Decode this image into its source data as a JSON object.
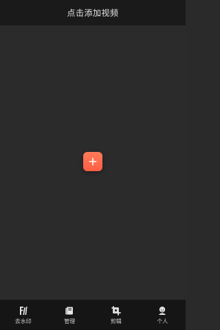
{
  "topbar": {
    "title": "点击添加视频"
  },
  "bottom_nav": {
    "items": [
      {
        "label": "去水印",
        "icon": "watermark-remove-icon"
      },
      {
        "label": "管理",
        "icon": "manage-icon"
      },
      {
        "label": "剪辑",
        "icon": "crop-icon"
      },
      {
        "label": "个人",
        "icon": "user-icon"
      }
    ]
  },
  "colors": {
    "topbar_bg": "#1a1a1a",
    "content_bg": "#2b2b2b",
    "bottom_bg": "#151515",
    "accent": "#ff6a4a"
  }
}
